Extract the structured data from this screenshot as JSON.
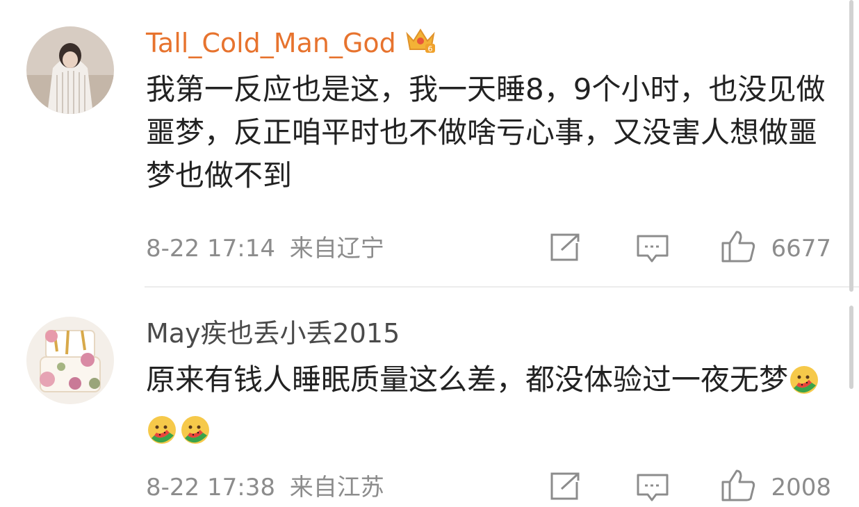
{
  "comments": [
    {
      "username": "Tall_Cold_Man_God",
      "text": "我第一反应也是这，我一天睡8，9个小时，也没见做噩梦，反正咱平时也不做啥亏心事，又没害人想做噩梦也做不到",
      "timestamp": "8-22 17:14",
      "location": "来自辽宁",
      "likes": "6677"
    },
    {
      "username": "May疾也丢小丢2015",
      "text": "原来有钱人睡眠质量这么差，都没体验过一夜无梦",
      "timestamp": "8-22 17:38",
      "location": "来自江苏",
      "likes": "2008"
    }
  ],
  "icons": {
    "vip_badge": "crown-icon",
    "share": "share-icon",
    "reply": "comment-icon",
    "like": "thumbs-up-icon",
    "emoji": "eating-watermelon-emoji"
  },
  "colors": {
    "vip_name": "#e7732e",
    "normal_name": "#4a4a4a",
    "text": "#222222",
    "meta": "#8c8c8c"
  }
}
